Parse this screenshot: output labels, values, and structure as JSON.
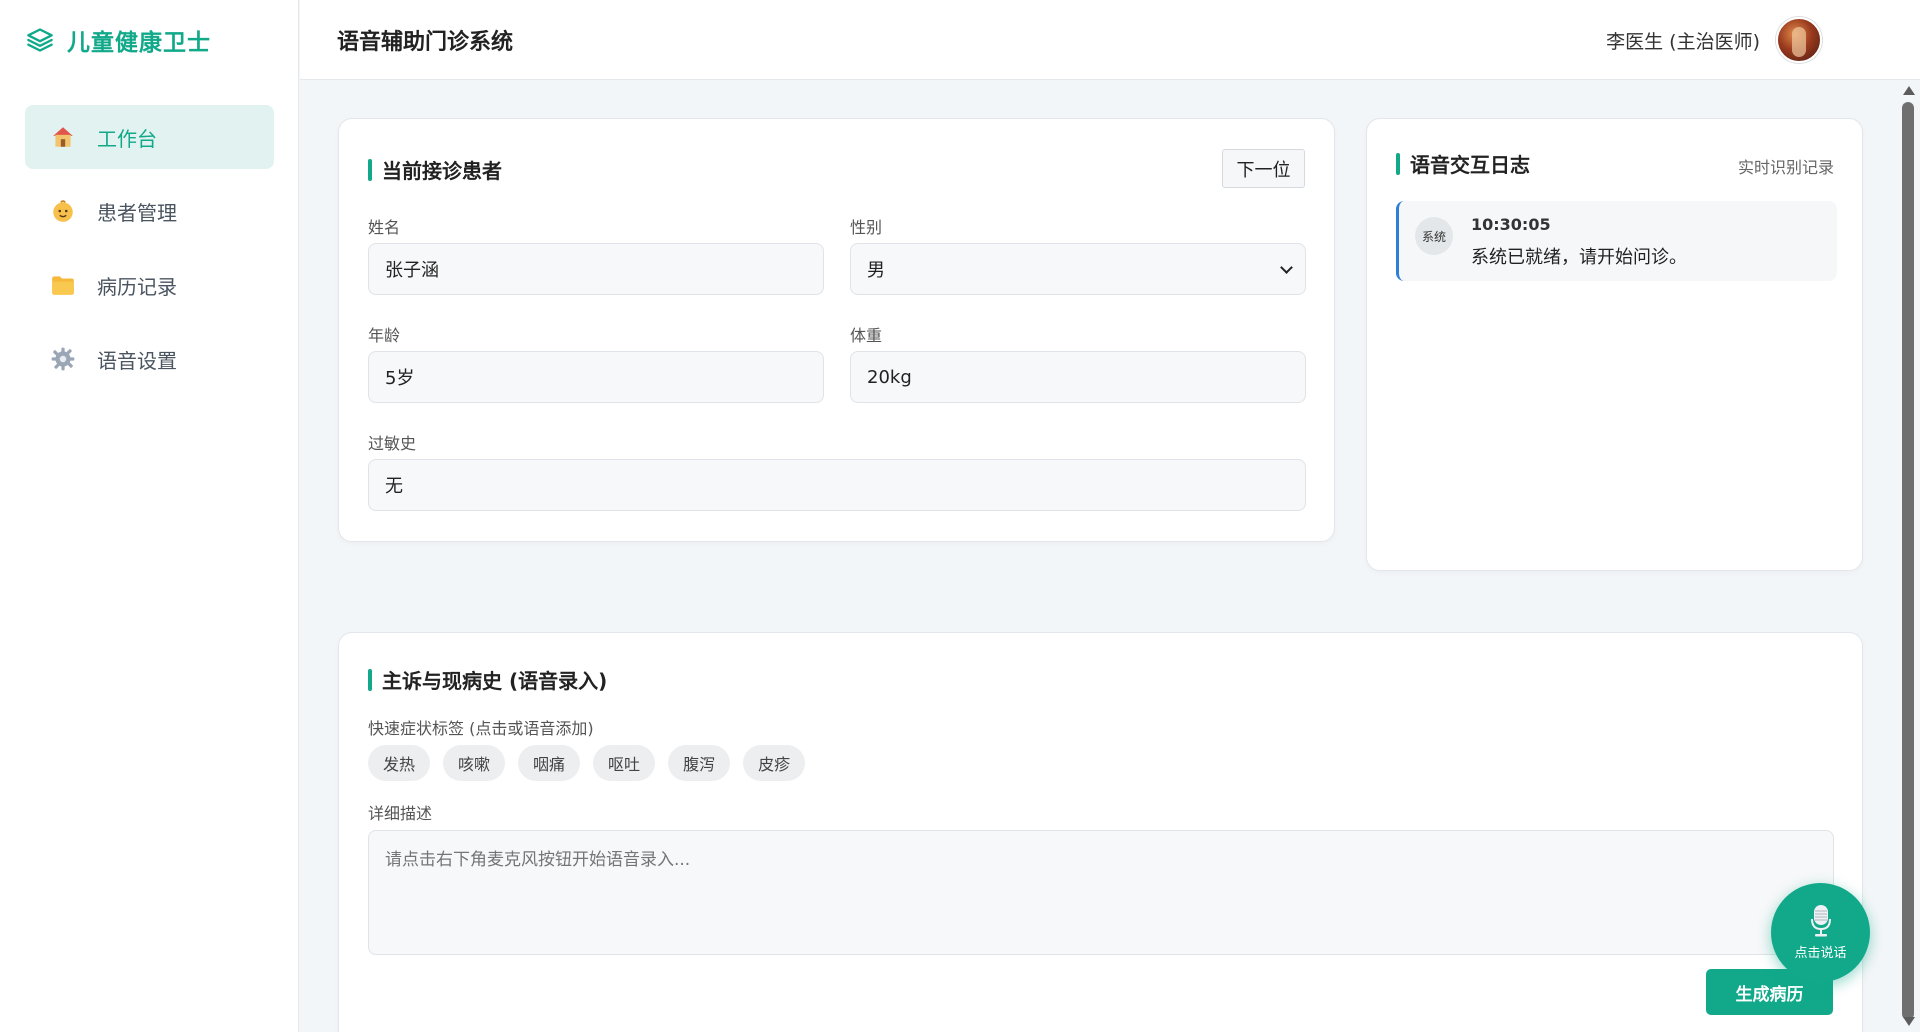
{
  "app": {
    "brand": "儿童健康卫士",
    "page_title": "语音辅助门诊系统"
  },
  "user": {
    "name": "李医生 (主治医师)"
  },
  "sidebar": {
    "items": [
      {
        "label": "工作台",
        "icon": "house-icon",
        "active": true
      },
      {
        "label": "患者管理",
        "icon": "baby-face-icon",
        "active": false
      },
      {
        "label": "病历记录",
        "icon": "folder-icon",
        "active": false
      },
      {
        "label": "语音设置",
        "icon": "gear-icon",
        "active": false
      }
    ]
  },
  "patient": {
    "title": "当前接诊患者",
    "next_label": "下一位",
    "name_label": "姓名",
    "name_value": "张子涵",
    "gender_label": "性别",
    "gender_value": "男",
    "age_label": "年龄",
    "age_value": "5岁",
    "weight_label": "体重",
    "weight_value": "20kg",
    "allergy_label": "过敏史",
    "allergy_value": "无"
  },
  "log": {
    "title": "语音交互日志",
    "subtitle": "实时识别记录",
    "entries": [
      {
        "badge": "系统",
        "time": "10:30:05",
        "message": "系统已就绪，请开始问诊。"
      }
    ]
  },
  "complaint": {
    "title": "主诉与现病史 (语音录入)",
    "tags_label": "快速症状标签 (点击或语音添加)",
    "tags": [
      "发热",
      "咳嗽",
      "咽痛",
      "呕吐",
      "腹泻",
      "皮疹"
    ],
    "detail_label": "详细描述",
    "detail_placeholder": "请点击右下角麦克风按钮开始语音录入...",
    "generate_label": "生成病历"
  },
  "mic": {
    "label": "点击说话"
  },
  "colors": {
    "accent": "#11a98a",
    "log_border": "#2f7fd6"
  }
}
